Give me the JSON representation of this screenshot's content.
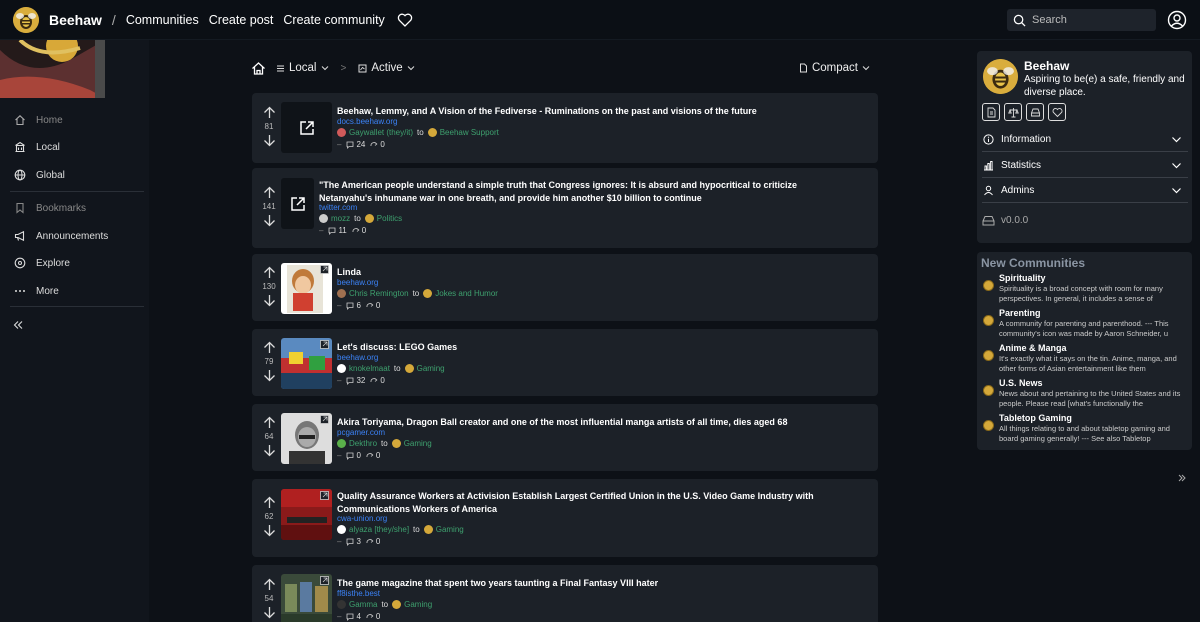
{
  "header": {
    "brand": "Beehaw",
    "separator": "/",
    "nav": [
      "Communities",
      "Create post",
      "Create community"
    ],
    "search_placeholder": "Search"
  },
  "sidebar": {
    "items": [
      {
        "label": "Home",
        "icon": "home-icon",
        "muted": true
      },
      {
        "label": "Local",
        "icon": "building-icon",
        "muted": false
      },
      {
        "label": "Global",
        "icon": "globe-icon",
        "muted": false
      },
      {
        "label": "Bookmarks",
        "icon": "bookmark-icon",
        "muted": true
      },
      {
        "label": "Announcements",
        "icon": "megaphone-icon",
        "muted": false
      },
      {
        "label": "Explore",
        "icon": "compass-icon",
        "muted": false
      },
      {
        "label": "More",
        "icon": "ellipsis-icon",
        "muted": false
      }
    ]
  },
  "controls": {
    "listing": "Local",
    "sort": "Active",
    "view": "Compact",
    "breadcrumb_sep": ">"
  },
  "posts": [
    {
      "score": "81",
      "title": "Beehaw, Lemmy, and A Vision of the Fediverse - Ruminations on the past and visions of the future",
      "domain": "docs.beehaw.org",
      "user": "Gaywallet (they/it)",
      "to": "to",
      "community": "Beehaw Support",
      "comments": "24",
      "crossposts": "0",
      "thumb": "link"
    },
    {
      "score": "141",
      "title": "\"The American people understand a simple truth that Congress ignores: It is absurd and hypocritical to criticize Netanyahu's inhumane war in one breath, and provide him another $10 billion to continue",
      "domain": "twitter.com",
      "user": "mozz",
      "to": "to",
      "community": "Politics",
      "comments": "11",
      "crossposts": "0",
      "thumb": "link"
    },
    {
      "score": "130",
      "title": "Linda",
      "domain": "beehaw.org",
      "user": "Chris Remington",
      "to": "to",
      "community": "Jokes and Humor",
      "comments": "6",
      "crossposts": "0",
      "thumb": "linda"
    },
    {
      "score": "79",
      "title": "Let's discuss: LEGO Games",
      "domain": "beehaw.org",
      "user": "knokelmaat",
      "to": "to",
      "community": "Gaming",
      "comments": "32",
      "crossposts": "0",
      "thumb": "lego"
    },
    {
      "score": "64",
      "title": "Akira Toriyama, Dragon Ball creator and one of the most influential manga artists of all time, dies aged 68",
      "domain": "pcgamer.com",
      "user": "Dekthro",
      "to": "to",
      "community": "Gaming",
      "comments": "0",
      "crossposts": "0",
      "thumb": "akira"
    },
    {
      "score": "62",
      "title": "Quality Assurance Workers at Activision Establish Largest Certified Union in the U.S. Video Game Industry with Communications Workers of America",
      "domain": "cwa-union.org",
      "user": "alyaza [they/she]",
      "to": "to",
      "community": "Gaming",
      "comments": "3",
      "crossposts": "0",
      "thumb": "cwa"
    },
    {
      "score": "54",
      "title": "The game magazine that spent two years taunting a Final Fantasy VIII hater",
      "domain": "ff8isthe.best",
      "user": "Gamma",
      "to": "to",
      "community": "Gaming",
      "comments": "4",
      "crossposts": "0",
      "thumb": "ff8"
    }
  ],
  "site": {
    "name": "Beehaw",
    "description": "Aspiring to be(e) a safe, friendly and diverse place.",
    "sections": [
      "Information",
      "Statistics",
      "Admins"
    ],
    "version": "v0.0.0"
  },
  "new_communities": {
    "heading": "New Communities",
    "items": [
      {
        "name": "Spirituality",
        "desc": "Spirituality is a broad concept with room for many perspectives. In general, it includes a sense of"
      },
      {
        "name": "Parenting",
        "desc": "A community for parenting and parenthood. --- This community's icon was made by Aaron Schneider, u"
      },
      {
        "name": "Anime & Manga",
        "desc": "It's exactly what it says on the tin. Anime, manga, and other forms of Asian entertainment like them"
      },
      {
        "name": "U.S. News",
        "desc": "News about and pertaining to the United States and its people. Please read [what's functionally the"
      },
      {
        "name": "Tabletop Gaming",
        "desc": "All things relating to and about tabletop gaming and board gaming generally! --- See also Tabletop"
      }
    ]
  }
}
